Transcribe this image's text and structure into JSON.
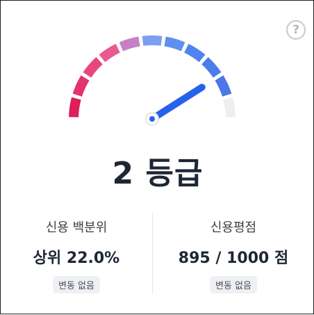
{
  "gauge": {
    "grade_number": "2",
    "grade_unit": "등급",
    "needle_fraction": 0.82,
    "segment_colors": [
      "#dc1f58",
      "#e4326c",
      "#e8467f",
      "#ea5a92",
      "#c77fc6",
      "#7c9ef0",
      "#5f8ff0",
      "#4f83ee",
      "#4b7deb",
      "#4a78e6",
      "#eeeeee"
    ],
    "needle_color": "#2563eb",
    "hub_color": "#ffffff"
  },
  "help_icon": {
    "symbol": "?",
    "name": "help-icon"
  },
  "credit_percentile": {
    "label": "신용 백분위",
    "value": "상위 22.0%",
    "change": "변동 없음"
  },
  "credit_score": {
    "label": "신용평점",
    "value": "895 / 1000 점",
    "change": "변동 없음"
  }
}
